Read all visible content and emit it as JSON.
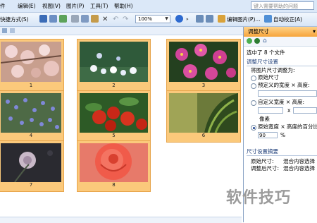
{
  "menu": {
    "items": [
      {
        "label": "件"
      },
      {
        "label": "编辑(E)"
      },
      {
        "label": "视图(V)"
      },
      {
        "label": "图片(P)"
      },
      {
        "label": "工具(T)"
      },
      {
        "label": "帮助(H)"
      }
    ],
    "help_placeholder": "键入需要帮助的问题"
  },
  "toolbar": {
    "shortcuts_label": "快捷方式(S)",
    "zoom_value": "100%",
    "edit_picture_label": "编辑图片(P)...",
    "auto_correct_label": "自动校正(A)"
  },
  "thumbnails": [
    {
      "number": "1"
    },
    {
      "number": "2"
    },
    {
      "number": "3"
    },
    {
      "number": "4"
    },
    {
      "number": "5"
    },
    {
      "number": "6"
    },
    {
      "number": "7"
    },
    {
      "number": "8"
    }
  ],
  "pane": {
    "title": "调整尺寸",
    "selection_info": "选中了 8 个文件",
    "section_settings": "调整尺寸设置",
    "resize_to_label": "将图片尺寸调整为:",
    "option_original": "原始尺寸",
    "option_predefined": "预定义的宽度 × 高度:",
    "option_custom": "自定义宽度 × 高度:",
    "custom_x": "x",
    "unit_pixels": "像素",
    "option_percent": "原始宽度 × 高度的百分比",
    "percent_value": "90",
    "percent_unit": "%",
    "section_summary": "尺寸设置摘要",
    "summary_original_label": "原始尺寸:",
    "summary_original_value": "混合内容选择",
    "summary_adjusted_label": "调整后尺寸:",
    "summary_adjusted_value": "混合内容选择"
  },
  "watermark": "软件技巧",
  "colors": {
    "thumb_frame": "#fbc97b",
    "pane_header": "#f6a43b",
    "menubar": "#dbe8f8"
  }
}
